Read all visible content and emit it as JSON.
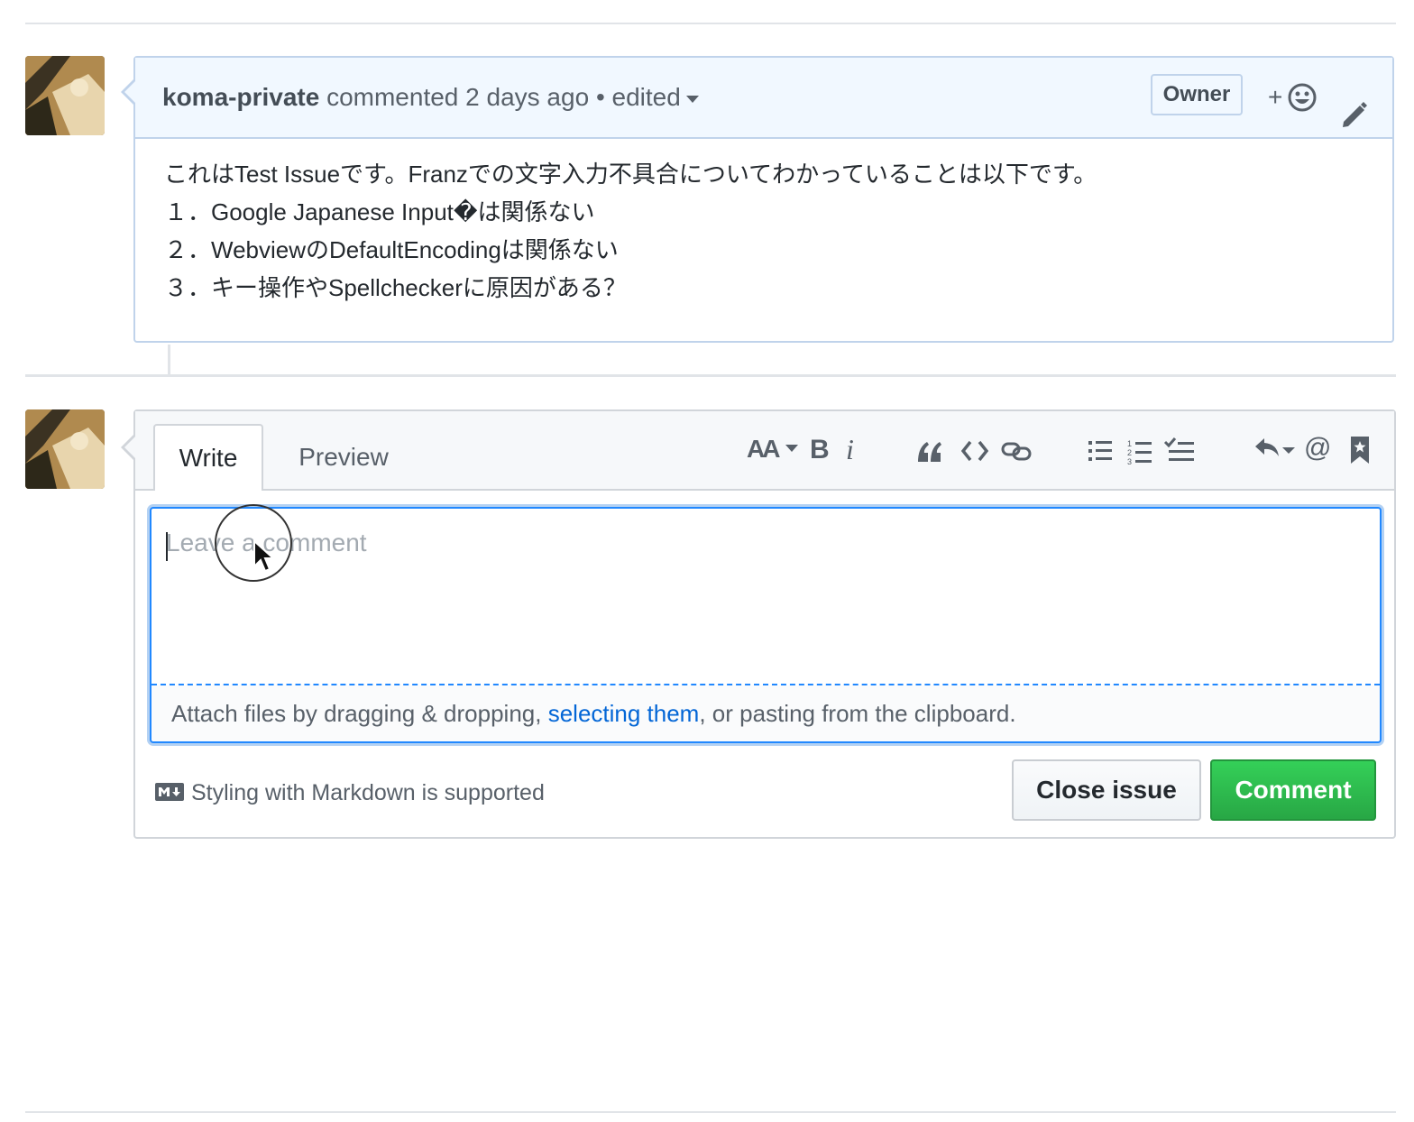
{
  "comment": {
    "author": "koma-private",
    "action": "commented",
    "time": "2 days ago",
    "separator": "•",
    "edited": "edited",
    "badge": "Owner",
    "reaction_plus": "+",
    "body_lines": [
      "これはTest Issueです。Franzでの文字入力不具合についてわかっていることは以下です。",
      "１．Google Japanese Input�は関係ない",
      "２．WebviewのDefaultEncodingは関係ない",
      "３．キー操作やSpellcheckerに原因がある？"
    ]
  },
  "form": {
    "tabs": {
      "write": "Write",
      "preview": "Preview"
    },
    "toolbar": {
      "heading_label": "AA",
      "bold_label": "B",
      "italic_label": "i",
      "mention_label": "@"
    },
    "textarea": {
      "placeholder": "Leave a comment",
      "value": ""
    },
    "attach": {
      "prefix": "Attach files by dragging & dropping, ",
      "link": "selecting them",
      "suffix": ", or pasting from the clipboard."
    },
    "markdown_note": "Styling with Markdown is supported",
    "buttons": {
      "close": "Close issue",
      "comment": "Comment"
    }
  },
  "icons": [
    "avatar",
    "smiley-icon",
    "pencil-icon",
    "heading-icon",
    "bold-icon",
    "italic-icon",
    "quote-icon",
    "code-icon",
    "link-icon",
    "unordered-list-icon",
    "ordered-list-icon",
    "task-list-icon",
    "reply-icon",
    "mention-icon",
    "bookmark-icon",
    "markdown-icon",
    "mouse-pointer-icon"
  ],
  "colors": {
    "accent_blue": "#0366d6",
    "comment_header_bg": "#f1f8ff",
    "comment_border": "#c0d3eb",
    "button_green": "#28a745",
    "focus_blue": "#2188ff"
  }
}
